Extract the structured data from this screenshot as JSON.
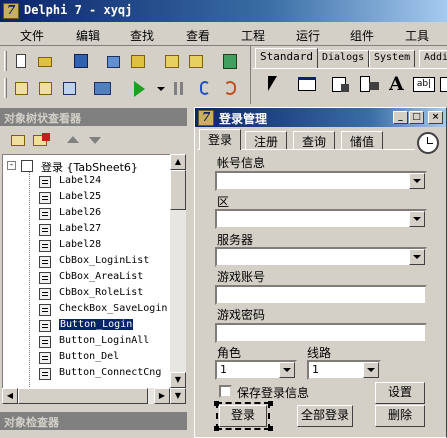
{
  "app": {
    "title": "Delphi 7 - xyqj"
  },
  "menu": [
    "文件",
    "编辑",
    "查找",
    "查看",
    "工程",
    "运行",
    "组件",
    "工具"
  ],
  "palette": {
    "tabs": [
      "Standard",
      "Dialogs",
      "System",
      "Addi"
    ],
    "active": "Standard"
  },
  "object_tree": {
    "title": "对象树状查看器",
    "root": "登录 {TabSheet6}",
    "items": [
      "Label24",
      "Label25",
      "Label26",
      "Label27",
      "Label28",
      "CbBox_LoginList",
      "CbBox_AreaList",
      "CbBox_RoleList",
      "CheckBox_SaveLogin",
      "Button_Login",
      "Button_LoginAll",
      "Button_Del",
      "Button_ConnectCng"
    ],
    "selected": "Button_Login"
  },
  "object_inspector": {
    "title": "对象检查器"
  },
  "form": {
    "title": "登录管理",
    "tabs": [
      "登录",
      "注册",
      "查询",
      "储值"
    ],
    "active_tab": "登录",
    "fields": {
      "account_info": "帐号信息",
      "area": "区",
      "server": "服务器",
      "game_account": "游戏账号",
      "game_password": "游戏密码",
      "role": "角色",
      "line": "线路"
    },
    "role_value": "1",
    "line_value": "1",
    "save_login_label": "保存登录信息",
    "buttons": {
      "settings": "设置",
      "login": "登录",
      "login_all": "全部登录",
      "delete": "删除"
    }
  },
  "icons": [
    "delphi-logo-icon",
    "open-icon",
    "save-icon",
    "save-all-icon",
    "open-project-icon",
    "run-icon",
    "pause-icon",
    "step-icon",
    "pointer-icon",
    "frame-icon",
    "mainmenu-icon",
    "popupmenu-icon",
    "label-icon",
    "edit-icon",
    "clock-icon"
  ]
}
